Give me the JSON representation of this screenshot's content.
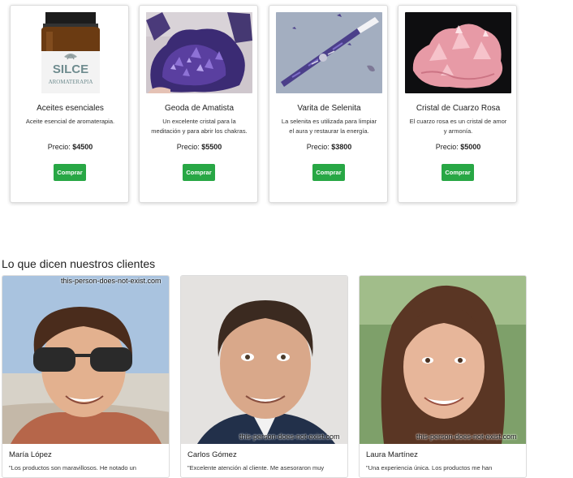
{
  "products": [
    {
      "name": "Aceites esenciales",
      "description": "Aceite esencial de aromaterapia.",
      "price_label": "Precio:",
      "price": "$4500",
      "button": "Comprar",
      "image_icon": "essential-oil-bottle-image"
    },
    {
      "name": "Geoda de Amatista",
      "description": "Un excelente cristal para la meditación y para abrir los chakras.",
      "price_label": "Precio:",
      "price": "$5500",
      "button": "Comprar",
      "image_icon": "amethyst-geode-image"
    },
    {
      "name": "Varita de Selenita",
      "description": "La selenita es utilizada para limpiar el aura y restaurar la energía.",
      "price_label": "Precio:",
      "price": "$3800",
      "button": "Comprar",
      "image_icon": "selenite-wand-image"
    },
    {
      "name": "Cristal de Cuarzo Rosa",
      "description": "El cuarzo rosa es un cristal de amor y armonía.",
      "price_label": "Precio:",
      "price": "$5000",
      "button": "Comprar",
      "image_icon": "rose-quartz-image"
    }
  ],
  "bottle_label": {
    "brand": "SILCE",
    "line": "AROMATERAPIA"
  },
  "testimonials_title": "Lo que dicen nuestros clientes",
  "testimonials": [
    {
      "name": "María López",
      "quote": "\"Los productos son maravillosos. He notado un",
      "watermark": "this-person-does-not-exist.com"
    },
    {
      "name": "Carlos Gómez",
      "quote": "\"Excelente atención al cliente. Me asesoraron muy",
      "watermark": "this-person-does-not-exist.com"
    },
    {
      "name": "Laura Martínez",
      "quote": "\"Una experiencia única. Los productos me han",
      "watermark": "this-person-does-not-exist.com"
    }
  ],
  "colors": {
    "button": "#28a745",
    "card_border": "#dcdcdc"
  }
}
